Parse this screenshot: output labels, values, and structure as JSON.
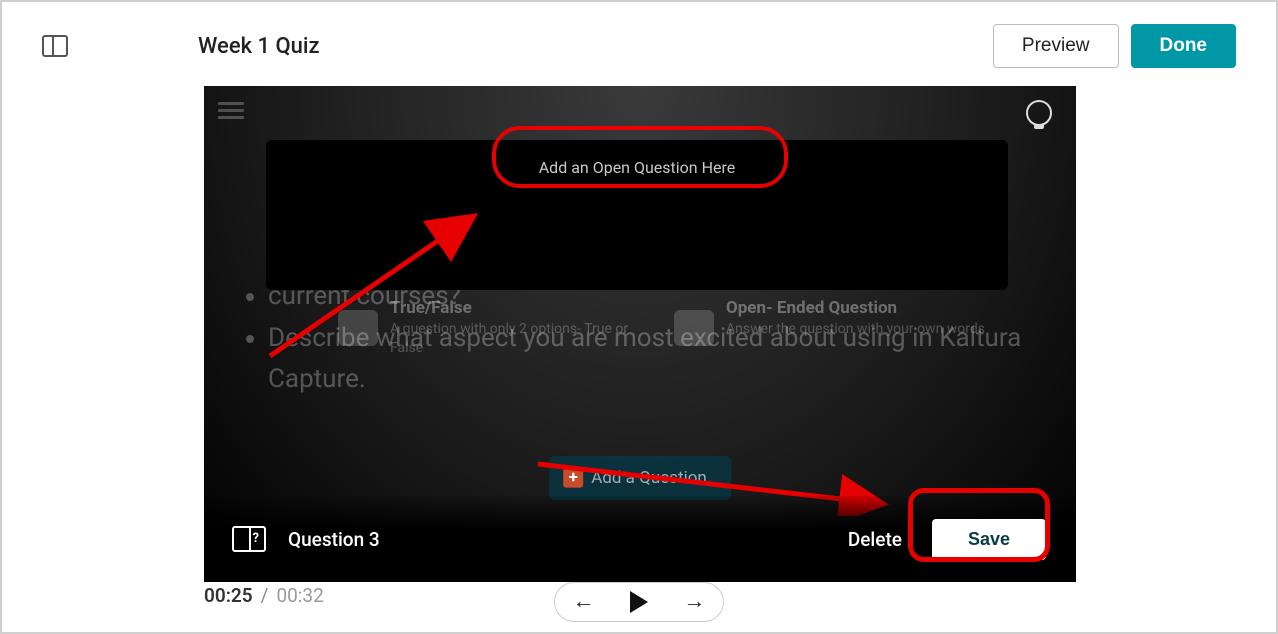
{
  "header": {
    "title": "Week 1 Quiz",
    "preview_label": "Preview",
    "done_label": "Done"
  },
  "question_box": {
    "placeholder": "Add an Open Question Here"
  },
  "options": {
    "tf_title": "True/False",
    "tf_sub": "A question with only 2 options- True or False",
    "open_title": "Open- Ended Question",
    "open_sub": "Answer the question with your own words"
  },
  "slide": {
    "line2a": "current courses?",
    "line3": "Describe what aspect you are most excited about using in Kaltura Capture."
  },
  "add_question_label": "Add a Question",
  "bottom": {
    "question_label": "Question 3",
    "delete_label": "Delete",
    "save_label": "Save"
  },
  "time": {
    "current": "00:25",
    "separator": "/",
    "duration": "00:32"
  }
}
